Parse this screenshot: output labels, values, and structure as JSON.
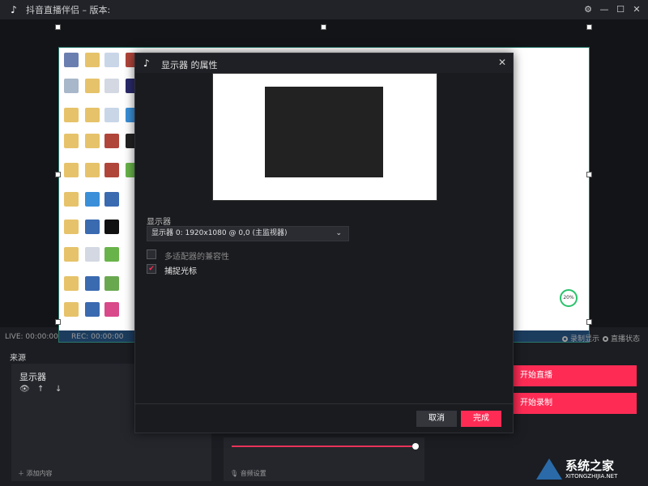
{
  "app": {
    "title": "抖音直播伴侣 – 版本:",
    "logo_icon": "douyin-logo",
    "window_controls": [
      "gear-icon",
      "minimize-icon",
      "maximize-icon",
      "close-icon"
    ]
  },
  "status_bar": {
    "live": "LIVE: 00:00:00",
    "rec": "REC: 00:00:00",
    "toggle1": "录制显示",
    "toggle2": "直播状态"
  },
  "sources": {
    "heading": "来源",
    "item": "显示器",
    "add_label": "添加内容",
    "item_icons": [
      "eye-icon",
      "arrow-up-icon",
      "arrow-down-icon"
    ]
  },
  "audio": {
    "settings_label": "音频设置",
    "volume_fraction": 1.0
  },
  "actions": {
    "start_live": "开始直播",
    "start_record": "开始录制"
  },
  "dialog": {
    "title": "显示器 的属性",
    "field_label": "显示器",
    "select_value": "显示器 0: 1920x1080 @ 0,0 (主监视器)",
    "checkbox_multi_adapter": {
      "label": "多适配器的兼容性",
      "checked": false
    },
    "checkbox_capture_cursor": {
      "label": "捕捉光标",
      "checked": true
    },
    "cancel": "取消",
    "done": "完成"
  },
  "preview_badge": "20%",
  "watermark": {
    "text": "系统之家",
    "sub": "XITONGZHIJIA.NET"
  },
  "colors": {
    "accent": "#fe2c55",
    "panel": "#24262c",
    "background": "#1b1d22"
  }
}
